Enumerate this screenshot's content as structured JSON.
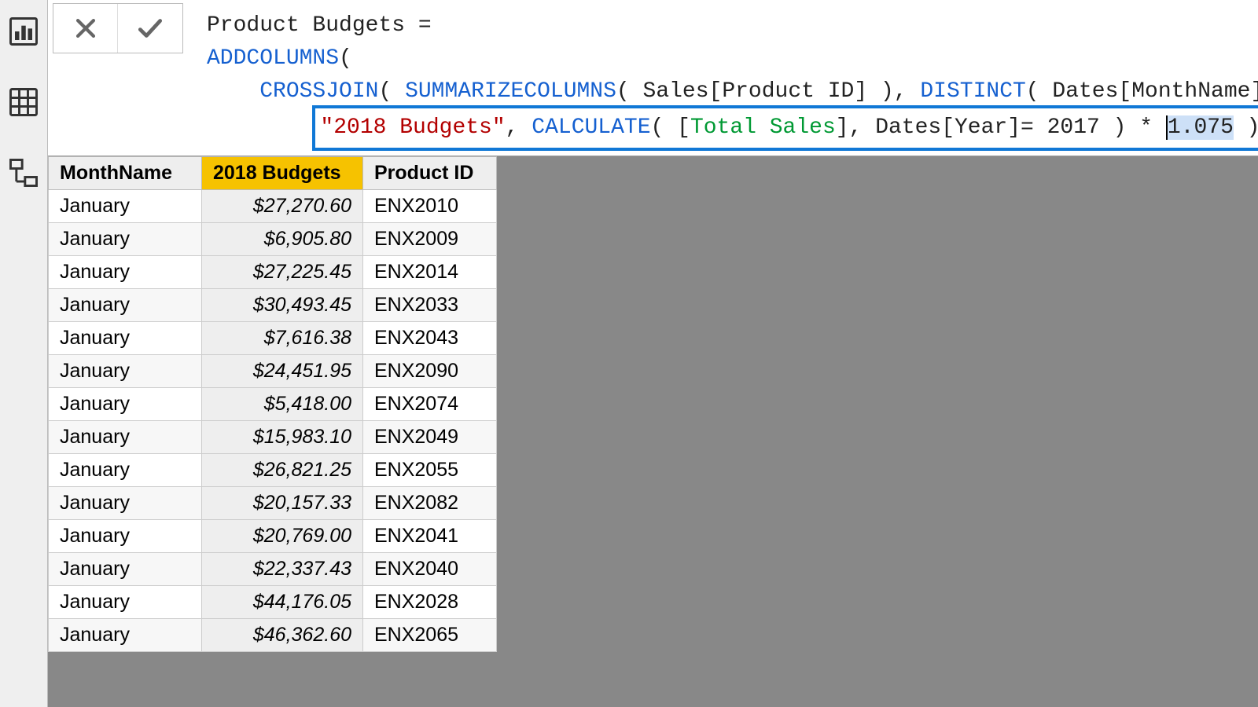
{
  "nav": {
    "report_icon": "report-view-icon",
    "data_icon": "data-view-icon",
    "model_icon": "model-view-icon"
  },
  "formula": {
    "line1_name": "Product Budgets = ",
    "line2_fn": "ADDCOLUMNS",
    "line2_rest": "(",
    "line3_fn1": "CROSSJOIN",
    "line3_p1": "( ",
    "line3_fn2": "SUMMARIZECOLUMNS",
    "line3_p2": "( Sales[Product ID] ), ",
    "line3_fn3": "DISTINCT",
    "line3_p3": "( Dates[MonthName] ) ),",
    "line4_str": "\"2018 Budgets\"",
    "line4_c1": ", ",
    "line4_fn": "CALCULATE",
    "line4_p1": "( [",
    "line4_col": "Total Sales",
    "line4_p2": "], Dates[Year]= 2017 ) * ",
    "line4_num": "1.075",
    "line4_p3": " )"
  },
  "table": {
    "headers": {
      "month": "MonthName",
      "budget": "2018 Budgets",
      "product": "Product ID"
    },
    "rows": [
      {
        "month": "January",
        "budget": "$27,270.60",
        "product": "ENX2010"
      },
      {
        "month": "January",
        "budget": "$6,905.80",
        "product": "ENX2009"
      },
      {
        "month": "January",
        "budget": "$27,225.45",
        "product": "ENX2014"
      },
      {
        "month": "January",
        "budget": "$30,493.45",
        "product": "ENX2033"
      },
      {
        "month": "January",
        "budget": "$7,616.38",
        "product": "ENX2043"
      },
      {
        "month": "January",
        "budget": "$24,451.95",
        "product": "ENX2090"
      },
      {
        "month": "January",
        "budget": "$5,418.00",
        "product": "ENX2074"
      },
      {
        "month": "January",
        "budget": "$15,983.10",
        "product": "ENX2049"
      },
      {
        "month": "January",
        "budget": "$26,821.25",
        "product": "ENX2055"
      },
      {
        "month": "January",
        "budget": "$20,157.33",
        "product": "ENX2082"
      },
      {
        "month": "January",
        "budget": "$20,769.00",
        "product": "ENX2041"
      },
      {
        "month": "January",
        "budget": "$22,337.43",
        "product": "ENX2040"
      },
      {
        "month": "January",
        "budget": "$44,176.05",
        "product": "ENX2028"
      },
      {
        "month": "January",
        "budget": "$46,362.60",
        "product": "ENX2065"
      }
    ]
  }
}
